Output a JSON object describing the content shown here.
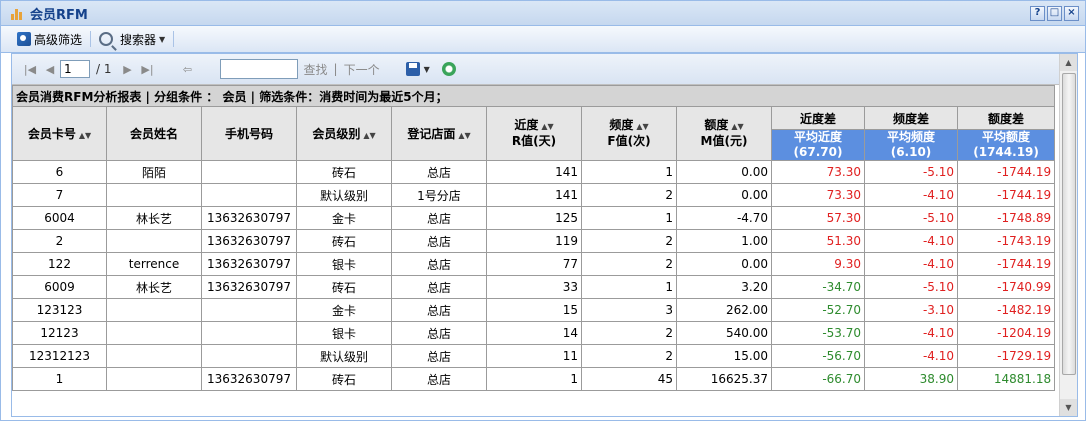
{
  "window": {
    "title": "会员RFM"
  },
  "toolbar": {
    "advanced_filter": "高级筛选",
    "searcher": "搜索器"
  },
  "pager": {
    "current_page": "1",
    "total": "/ 1",
    "find_label": "查找",
    "next_label": "下一个"
  },
  "report": {
    "title": "会员消费RFM分析报表 | 分组条件 ： 会员 | 筛选条件：消费时间为最近5个月；",
    "group_headers": [
      "近度差",
      "频度差",
      "额度差"
    ],
    "columns": [
      "会员卡号",
      "会员姓名",
      "手机号码",
      "会员级别",
      "登记店面",
      "近度",
      "R值(天)",
      "频度",
      "F值(次)",
      "额度",
      "M值(元)"
    ],
    "avg_headers": [
      {
        "label": "平均近度",
        "value": "(67.70)"
      },
      {
        "label": "平均频度",
        "value": "(6.10)"
      },
      {
        "label": "平均额度",
        "value": "(1744.19)"
      }
    ],
    "rows": [
      [
        "6",
        "陌陌",
        "",
        "砖石",
        "总店",
        "141",
        "1",
        "0.00",
        "73.30",
        "-5.10",
        "-1744.19"
      ],
      [
        "7",
        "",
        "",
        "默认级别",
        "1号分店",
        "141",
        "2",
        "0.00",
        "73.30",
        "-4.10",
        "-1744.19"
      ],
      [
        "6004",
        "林长艺",
        "13632630797",
        "金卡",
        "总店",
        "125",
        "1",
        "-4.70",
        "57.30",
        "-5.10",
        "-1748.89"
      ],
      [
        "2",
        "",
        "13632630797",
        "砖石",
        "总店",
        "119",
        "2",
        "1.00",
        "51.30",
        "-4.10",
        "-1743.19"
      ],
      [
        "122",
        "terrence",
        "13632630797",
        "银卡",
        "总店",
        "77",
        "2",
        "0.00",
        "9.30",
        "-4.10",
        "-1744.19"
      ],
      [
        "6009",
        "林长艺",
        "13632630797",
        "砖石",
        "总店",
        "33",
        "1",
        "3.20",
        "-34.70",
        "-5.10",
        "-1740.99"
      ],
      [
        "123123",
        "",
        "",
        "金卡",
        "总店",
        "15",
        "3",
        "262.00",
        "-52.70",
        "-3.10",
        "-1482.19"
      ],
      [
        "12123",
        "",
        "",
        "银卡",
        "总店",
        "14",
        "2",
        "540.00",
        "-53.70",
        "-4.10",
        "-1204.19"
      ],
      [
        "12312123",
        "",
        "",
        "默认级别",
        "总店",
        "11",
        "2",
        "15.00",
        "-56.70",
        "-4.10",
        "-1729.19"
      ],
      [
        "1",
        "",
        "13632630797",
        "砖石",
        "总店",
        "1",
        "45",
        "16625.37",
        "-66.70",
        "38.90",
        "14881.18"
      ]
    ]
  },
  "colors": {
    "positive": "#e02020",
    "negative": "#2e8b2e",
    "highlight_header": "#5c8fe0"
  }
}
